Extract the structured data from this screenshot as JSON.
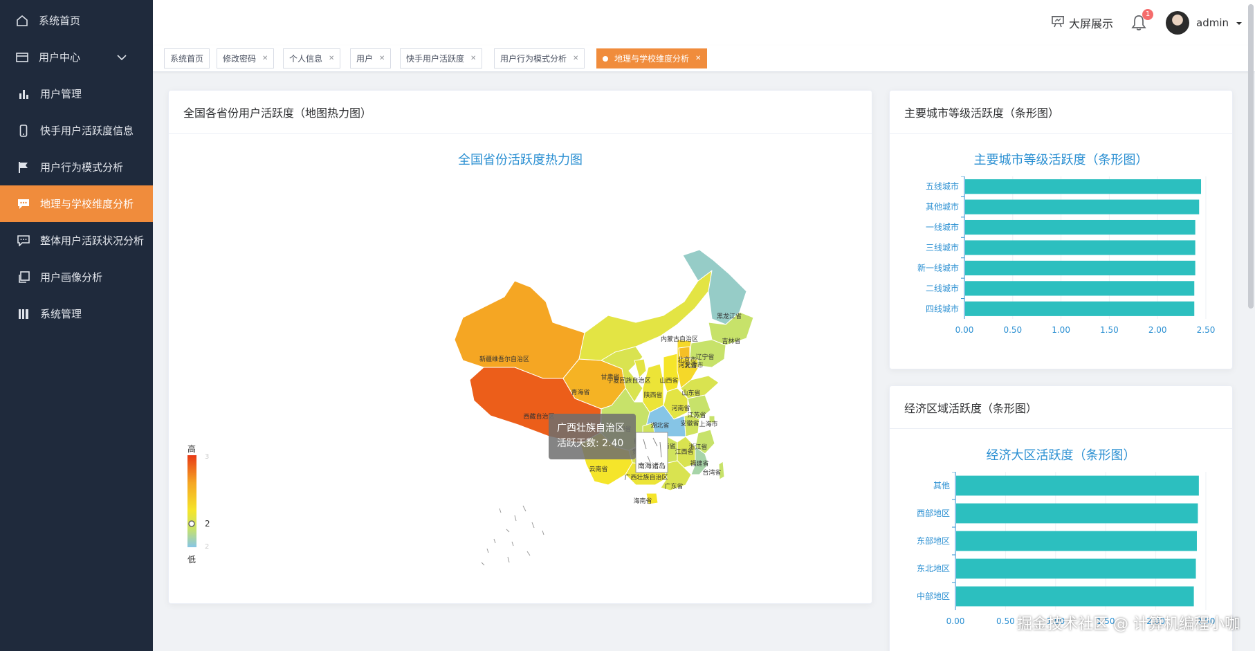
{
  "sidebar": {
    "items": [
      {
        "label": "系统首页",
        "icon": "home-icon"
      },
      {
        "label": "用户中心",
        "icon": "credit-card-icon"
      },
      {
        "label": "用户管理",
        "icon": "bar-chart-icon"
      },
      {
        "label": "快手用户活跃度信息",
        "icon": "phone-icon"
      },
      {
        "label": "用户行为模式分析",
        "icon": "flag-icon"
      },
      {
        "label": "地理与学校维度分析",
        "icon": "chat-icon",
        "active": true
      },
      {
        "label": "整体用户活跃状况分析",
        "icon": "message-icon"
      },
      {
        "label": "用户画像分析",
        "icon": "copy-icon"
      },
      {
        "label": "系统管理",
        "icon": "book-icon"
      }
    ]
  },
  "header": {
    "screen_label": "大屏展示",
    "notification_count": "1",
    "username": "admin"
  },
  "tags": [
    {
      "label": "系统首页",
      "closable": false
    },
    {
      "label": "修改密码",
      "closable": true
    },
    {
      "label": "个人信息",
      "closable": true
    },
    {
      "label": "用户",
      "closable": true
    },
    {
      "label": "快手用户活跃度",
      "closable": true
    },
    {
      "label": "用户行为模式分析",
      "closable": true
    },
    {
      "label": "地理与学校维度分析",
      "closable": true,
      "active": true
    }
  ],
  "map_card": {
    "header": "全国各省份用户活跃度（地图热力图）",
    "chart_title": "全国省份活跃度热力图",
    "legend": {
      "high": "高",
      "low": "低",
      "max_tick": "3",
      "current": "2",
      "min_tick": "2"
    },
    "tooltip": {
      "name": "广西壮族自治区",
      "metric_label": "活跃天数",
      "value": "2.40",
      "line": "活跃天数: 2.40"
    },
    "south_sea_label": "南海诸岛"
  },
  "chart_data": [
    {
      "type": "map",
      "title": "全国省份活跃度热力图",
      "visual_range": [
        2,
        3
      ],
      "colors": {
        "high": "#e83a16",
        "mid": "#f5e52a",
        "low": "#86c5e6"
      },
      "regions": [
        {
          "name": "新疆维吾尔自治区",
          "value": 2.7
        },
        {
          "name": "西藏自治区",
          "value": 2.9
        },
        {
          "name": "青海省",
          "value": 2.65
        },
        {
          "name": "内蒙古自治区",
          "value": 2.35
        },
        {
          "name": "黑龙江省",
          "value": 2.05
        },
        {
          "name": "吉林省",
          "value": 2.2
        },
        {
          "name": "辽宁省",
          "value": 2.2
        },
        {
          "name": "甘肃省",
          "value": 2.3
        },
        {
          "name": "宁夏回族自治区",
          "value": 2.35
        },
        {
          "name": "陕西省",
          "value": 2.4
        },
        {
          "name": "山西省",
          "value": 2.45
        },
        {
          "name": "河北省",
          "value": 2.5
        },
        {
          "name": "北京市",
          "value": 2.6
        },
        {
          "name": "天津市",
          "value": 2.4
        },
        {
          "name": "山东省",
          "value": 2.3
        },
        {
          "name": "河南省",
          "value": 2.35
        },
        {
          "name": "江苏省",
          "value": 2.2
        },
        {
          "name": "安徽省",
          "value": 2.25
        },
        {
          "name": "上海市",
          "value": 2.2
        },
        {
          "name": "湖北省",
          "value": 1.95
        },
        {
          "name": "四川省",
          "value": 2.2
        },
        {
          "name": "重庆市",
          "value": 2.25
        },
        {
          "name": "浙江省",
          "value": 2.2
        },
        {
          "name": "湖南省",
          "value": 2.25
        },
        {
          "name": "江西省",
          "value": 2.3
        },
        {
          "name": "贵州省",
          "value": 2.3
        },
        {
          "name": "福建省",
          "value": 2.1
        },
        {
          "name": "云南省",
          "value": 2.45
        },
        {
          "name": "广西壮族自治区",
          "value": 2.4
        },
        {
          "name": "广东省",
          "value": 2.3
        },
        {
          "name": "台湾省",
          "value": 2.2
        },
        {
          "name": "海南省",
          "value": 2.45
        }
      ]
    },
    {
      "type": "bar",
      "orientation": "horizontal",
      "title": "主要城市等级活跃度（条形图）",
      "categories": [
        "五线城市",
        "其他城市",
        "一线城市",
        "三线城市",
        "新一线城市",
        "二线城市",
        "四线城市"
      ],
      "values": [
        2.45,
        2.43,
        2.39,
        2.39,
        2.39,
        2.38,
        2.38
      ],
      "xlim": [
        0,
        2.5
      ],
      "ticks": [
        "0.00",
        "0.50",
        "1.00",
        "1.50",
        "2.00",
        "2.50"
      ],
      "color": "#2cbfbf"
    },
    {
      "type": "bar",
      "orientation": "horizontal",
      "title": "经济大区活跃度（条形图）",
      "categories": [
        "其他",
        "西部地区",
        "东部地区",
        "东北地区",
        "中部地区"
      ],
      "values": [
        2.43,
        2.42,
        2.41,
        2.4,
        2.38
      ],
      "xlim": [
        0,
        2.5
      ],
      "ticks": [
        "0.00",
        "0.50",
        "1.00",
        "1.50",
        "2.00",
        "2.50"
      ],
      "color": "#2cbfbf"
    }
  ],
  "city_card": {
    "header": "主要城市等级活跃度（条形图）",
    "chart_title": "主要城市等级活跃度（条形图）"
  },
  "region_card": {
    "header": "经济区域活跃度（条形图）",
    "chart_title": "经济大区活跃度（条形图）"
  },
  "watermark": "掘金技术社区 @ 计算机编程小咖"
}
